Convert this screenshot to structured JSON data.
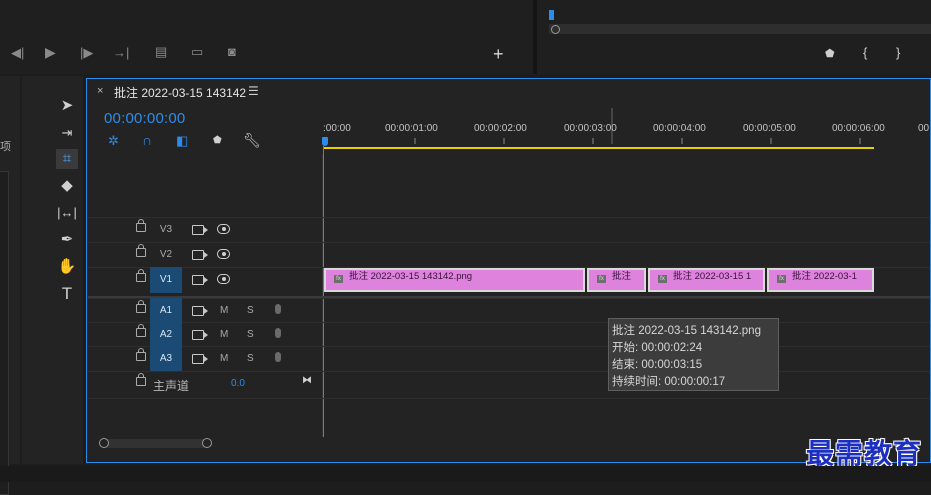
{
  "sequence": {
    "name": "批注 2022-03-15 143142",
    "timecode": "00:00:00:00"
  },
  "ruler": {
    "labels": [
      ":00:00",
      "00:00:01:00",
      "00:00:02:00",
      "00:00:03:00",
      "00:00:04:00",
      "00:00:05:00",
      "00:00:06:00",
      "00"
    ]
  },
  "tracks": {
    "video": [
      {
        "name": "V3"
      },
      {
        "name": "V2"
      },
      {
        "name": "V1"
      }
    ],
    "audio": [
      {
        "name": "A1",
        "m": "M",
        "s": "S"
      },
      {
        "name": "A2",
        "m": "M",
        "s": "S"
      },
      {
        "name": "A3",
        "m": "M",
        "s": "S"
      }
    ],
    "master": {
      "label": "主声道",
      "value": "0.0"
    }
  },
  "clips": [
    {
      "label": "批注 2022-03-15  143142.png"
    },
    {
      "label": "批注"
    },
    {
      "label": "批注 2022-03-15 1"
    },
    {
      "label": "批注 2022-03-1"
    }
  ],
  "tooltip": {
    "line1": "批注 2022-03-15 143142.png",
    "line2": "开始: 00:00:02:24",
    "line3": "结束: 00:00:03:15",
    "line4": "持续时间: 00:00:00:17"
  },
  "side_panel": {
    "cut_text": "项"
  },
  "watermark": "最需教育",
  "colors": {
    "accent": "#2d8ceb",
    "clip": "#dd82dd",
    "work_area": "#e7d200",
    "track_active": "#1b4a75"
  },
  "icons": [
    "close-icon",
    "menu-icon",
    "ripple-icon",
    "magnet-icon",
    "linked-selection-icon",
    "marker-icon",
    "wrench-icon",
    "selection-tool-icon",
    "track-select-tool-icon",
    "ripple-edit-tool-icon",
    "razor-tool-icon",
    "slip-tool-icon",
    "pen-tool-icon",
    "hand-tool-icon",
    "type-tool-icon"
  ]
}
